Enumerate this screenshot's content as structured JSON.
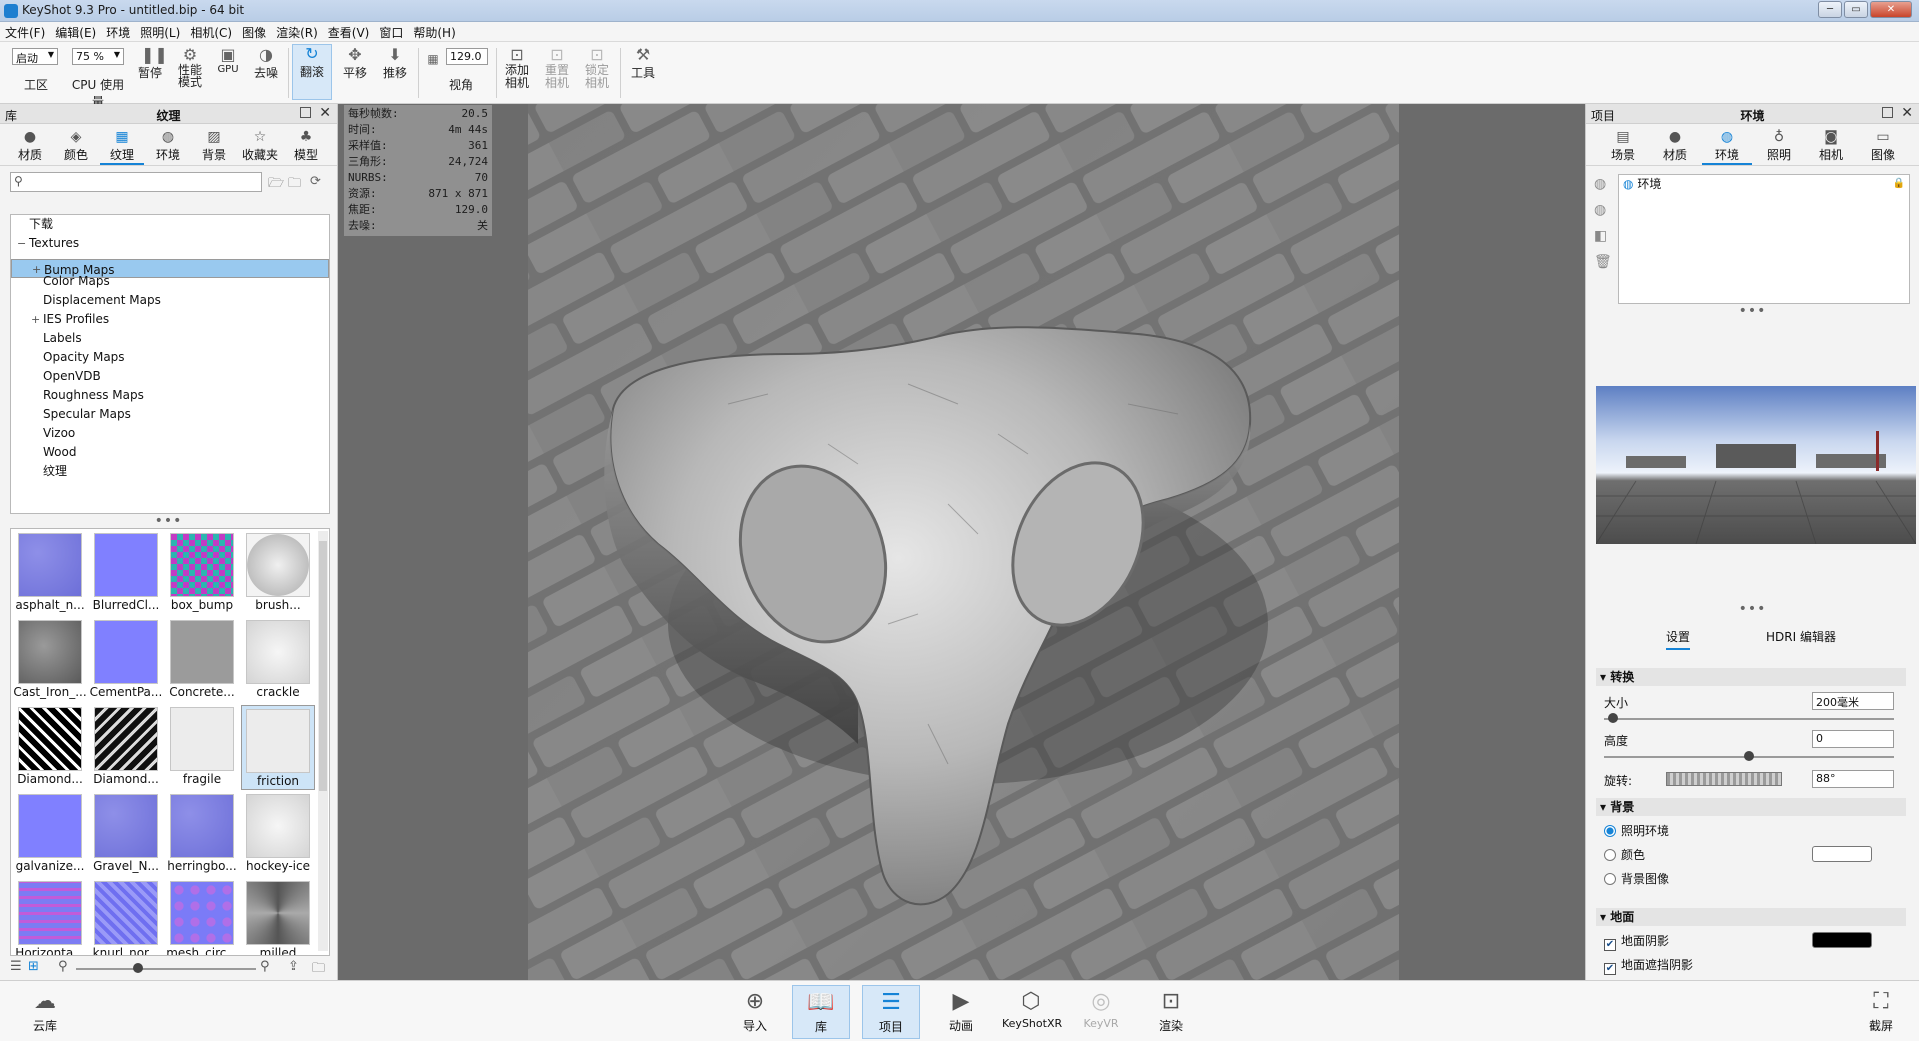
{
  "window": {
    "title": "KeyShot 9.3 Pro  - untitled.bip  - 64 bit",
    "minimize": "─",
    "maximize": "▭",
    "close": "✕"
  },
  "menu": [
    "文件(F)",
    "编辑(E)",
    "环境",
    "照明(L)",
    "相机(C)",
    "图像",
    "渲染(R)",
    "查看(V)",
    "窗口",
    "帮助(H)"
  ],
  "toolbar": {
    "startup_select": "启动",
    "zoom_select": "75 %",
    "workspace": "工区",
    "cpu_usage": "CPU 使用量",
    "pause": "暂停",
    "performance_mode": "性能\n模式",
    "gpu": "GPU",
    "denoise": "去噪",
    "tumble": "翻滚",
    "pan": "平移",
    "dolly": "推移",
    "fov_value": "129.0",
    "fov": "视角",
    "add_camera": "添加\n相机",
    "reset_camera": "重置\n相机",
    "lock_camera": "锁定\n相机",
    "tools": "工具"
  },
  "library": {
    "header_left": "库",
    "header_title": "纹理",
    "tabs": [
      "材质",
      "颜色",
      "纹理",
      "环境",
      "背景",
      "收藏夹",
      "模型"
    ],
    "active_tab": "纹理",
    "search_placeholder": "",
    "tree": [
      {
        "label": "下载",
        "indent": 0,
        "expander": ""
      },
      {
        "label": "Textures",
        "indent": 0,
        "expander": "−"
      },
      {
        "label": "Bump Maps",
        "indent": 1,
        "expander": "+",
        "selected": true
      },
      {
        "label": "Color Maps",
        "indent": 1,
        "expander": ""
      },
      {
        "label": "Displacement Maps",
        "indent": 1,
        "expander": ""
      },
      {
        "label": "IES Profiles",
        "indent": 1,
        "expander": "+"
      },
      {
        "label": "Labels",
        "indent": 1,
        "expander": ""
      },
      {
        "label": "Opacity Maps",
        "indent": 1,
        "expander": ""
      },
      {
        "label": "OpenVDB",
        "indent": 1,
        "expander": ""
      },
      {
        "label": "Roughness Maps",
        "indent": 1,
        "expander": ""
      },
      {
        "label": "Specular Maps",
        "indent": 1,
        "expander": ""
      },
      {
        "label": "Vizoo",
        "indent": 1,
        "expander": ""
      },
      {
        "label": "Wood",
        "indent": 1,
        "expander": ""
      },
      {
        "label": "纹理",
        "indent": 1,
        "expander": ""
      }
    ],
    "thumbnails": [
      {
        "label": "asphalt_n...",
        "style": "purple-noise"
      },
      {
        "label": "BlurredCl...",
        "style": "blue-flat"
      },
      {
        "label": "box_bump",
        "style": "rainbow-check"
      },
      {
        "label": "brush...",
        "style": "grey-radial"
      },
      {
        "label": "Cast_Iron_...",
        "style": "grey-dark"
      },
      {
        "label": "CementPa...",
        "style": "blue-flat"
      },
      {
        "label": "Concrete...",
        "style": "grey-mid"
      },
      {
        "label": "crackle",
        "style": "white-crackle"
      },
      {
        "label": "Diamond...",
        "style": "black-diamond"
      },
      {
        "label": "Diamond...",
        "style": "black-diamond-2"
      },
      {
        "label": "fragile",
        "style": "white-light"
      },
      {
        "label": "friction",
        "style": "white-light",
        "selected": true
      },
      {
        "label": "galvanize...",
        "style": "blue-flat"
      },
      {
        "label": "Gravel_N...",
        "style": "purple-noise"
      },
      {
        "label": "herringbo...",
        "style": "purple-noise"
      },
      {
        "label": "hockey-ice",
        "style": "white-crackle"
      },
      {
        "label": "Horizonta...",
        "style": "stripes"
      },
      {
        "label": "knurl_nor...",
        "style": "knurl"
      },
      {
        "label": "mesh_circ...",
        "style": "circles"
      },
      {
        "label": "milled",
        "style": "milled"
      }
    ]
  },
  "stats": [
    {
      "label": "每秒帧数:",
      "value": "20.5"
    },
    {
      "label": "时间:",
      "value": "4m 44s"
    },
    {
      "label": "采样值:",
      "value": "361"
    },
    {
      "label": "三角形:",
      "value": "24,724"
    },
    {
      "label": "NURBS:",
      "value": "70"
    },
    {
      "label": "资源:",
      "value": "871 x 871"
    },
    {
      "label": "焦距:",
      "value": "129.0"
    },
    {
      "label": "去噪:",
      "value": "关"
    }
  ],
  "project": {
    "header_left": "项目",
    "header_title": "环境",
    "tabs": [
      "场景",
      "材质",
      "环境",
      "照明",
      "相机",
      "图像"
    ],
    "active_tab": "环境",
    "env_item": "环境",
    "subtabs": [
      "设置",
      "HDRI 编辑器"
    ],
    "sections": {
      "transform": "转换",
      "background": "背景",
      "ground": "地面"
    },
    "size_label": "大小",
    "size_value": "200毫米",
    "height_label": "高度",
    "height_value": "0",
    "rotation_label": "旋转:",
    "rotation_value": "88°",
    "bg_options": [
      "照明环境",
      "颜色",
      "背景图像"
    ],
    "bg_selected": "照明环境",
    "ground_shadow": "地面阴影",
    "ground_occlusion": "地面遮挡阴影",
    "colors": {
      "bg_color": "#ffffff",
      "shadow_color": "#000000"
    }
  },
  "bottombar": {
    "cloud": "云库",
    "import": "导入",
    "library": "库",
    "project": "项目",
    "animation": "动画",
    "keyshotxr": "KeyShotXR",
    "keyvr": "KeyVR",
    "render": "渲染",
    "screenshot": "截屏"
  },
  "colors": {
    "accent": "#1583d6"
  }
}
